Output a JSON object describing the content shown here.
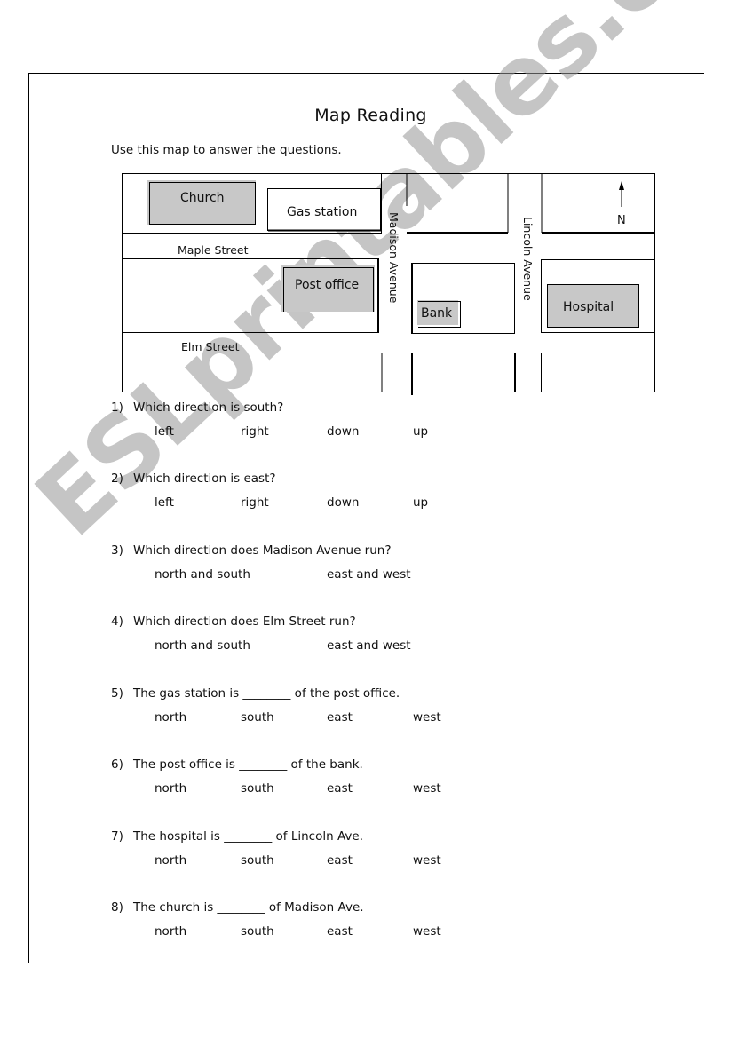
{
  "worksheet": {
    "title": "Map Reading",
    "instructions": "Use this map to answer the questions.",
    "watermark": "ESLprintables.com"
  },
  "map": {
    "compass_label": "N",
    "streets": {
      "maple": "Maple Street",
      "elm": "Elm Street",
      "madison": "Madison Avenue",
      "lincoln": "Lincoln Avenue"
    },
    "buildings": {
      "church": "Church",
      "gas_station": "Gas station",
      "post_office": "Post office",
      "bank": "Bank",
      "hospital": "Hospital"
    },
    "colors": {
      "building_fill": "#c8c8c8",
      "line": "#000000"
    }
  },
  "questions": [
    {
      "number": "1)",
      "text": "Which direction is south?",
      "options": [
        "left",
        "right",
        "down",
        "up"
      ]
    },
    {
      "number": "2)",
      "text": "Which direction is east?",
      "options": [
        "left",
        "right",
        "down",
        "up"
      ]
    },
    {
      "number": "3)",
      "text": "Which direction does Madison Avenue run?",
      "options": [
        "north and south",
        "east and west"
      ]
    },
    {
      "number": "4)",
      "text": "Which direction does Elm Street run?",
      "options": [
        "north and south",
        "east and west"
      ]
    },
    {
      "number": "5)",
      "text": "The gas station is ________ of the post office.",
      "options": [
        "north",
        "south",
        "east",
        "west"
      ]
    },
    {
      "number": "6)",
      "text": "The post office is ________ of the bank.",
      "options": [
        "north",
        "south",
        "east",
        "west"
      ]
    },
    {
      "number": "7)",
      "text": "The hospital is ________ of Lincoln Ave.",
      "options": [
        "north",
        "south",
        "east",
        "west"
      ]
    },
    {
      "number": "8)",
      "text": "The church is ________ of Madison Ave.",
      "options": [
        "north",
        "south",
        "east",
        "west"
      ]
    }
  ]
}
